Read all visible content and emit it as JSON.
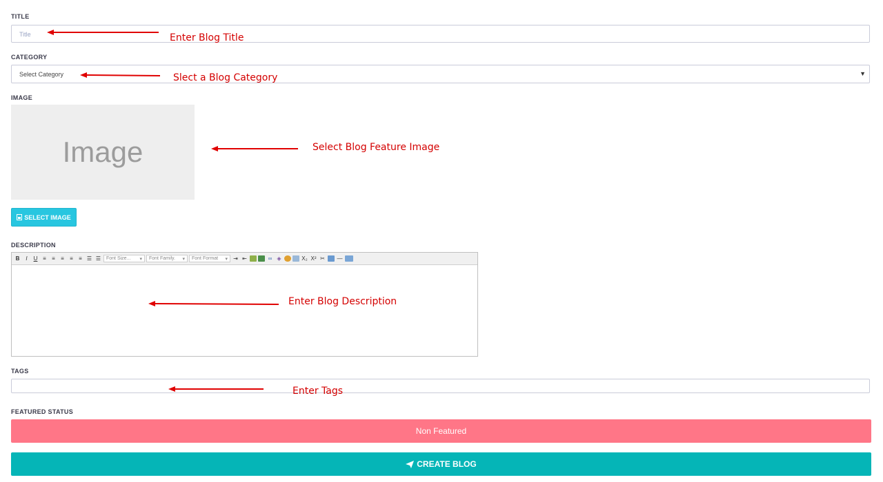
{
  "form": {
    "title": {
      "label": "TITLE",
      "placeholder": "Title"
    },
    "category": {
      "label": "CATEGORY",
      "selected": "Select Category"
    },
    "image": {
      "label": "IMAGE",
      "placeholder_text": "Image",
      "select_button": "SELECT IMAGE"
    },
    "description": {
      "label": "DESCRIPTION",
      "toolbar": {
        "bold": "B",
        "italic": "I",
        "underline": "U",
        "font_size": "Font Size...",
        "font_family": "Font Family.",
        "font_format": "Font Format",
        "subscript": "X₂",
        "superscript": "X²"
      }
    },
    "tags": {
      "label": "TAGS"
    },
    "featured": {
      "label": "FEATURED STATUS",
      "value": "Non Featured"
    },
    "submit": {
      "label": "CREATE BLOG"
    }
  },
  "annotations": {
    "title": "Enter Blog Title",
    "category": "Slect a Blog Category",
    "image": "Select Blog Feature Image",
    "description": "Enter Blog Description",
    "tags": "Enter Tags"
  },
  "icons": {
    "select_image": "image-file-icon",
    "submit": "paper-plane-icon",
    "category_dropdown": "caret-down-icon"
  },
  "colors": {
    "annotation": "#d40000",
    "select_button": "#28c6e0",
    "featured_status": "#ff7687",
    "create_button": "#05b5b7"
  }
}
